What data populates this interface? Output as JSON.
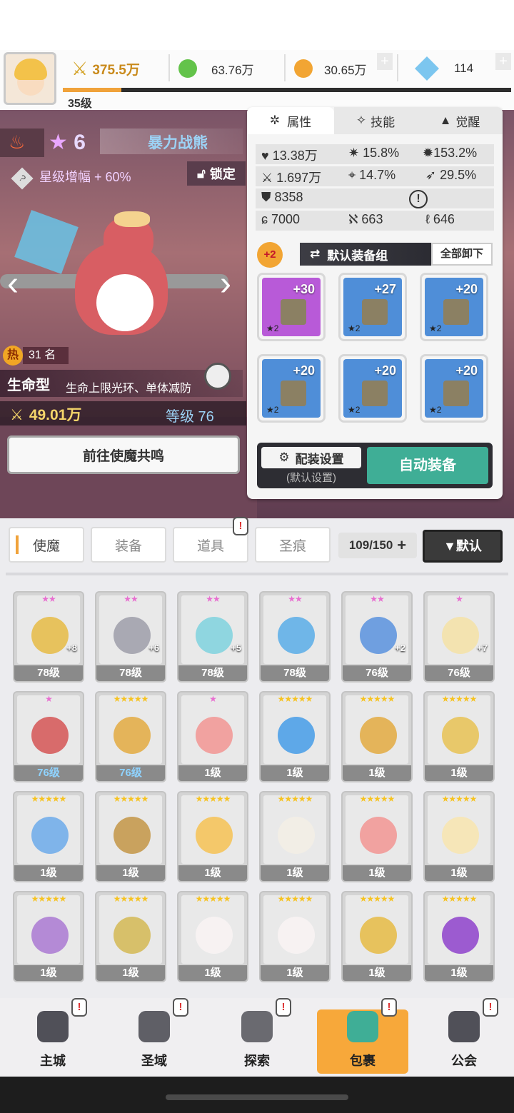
{
  "hud": {
    "level": "35级",
    "power": "375.5万",
    "gems": "63.76万",
    "coins": "30.65万",
    "crystals": "114",
    "xp_progress": 0.13
  },
  "hero": {
    "star_count": "6",
    "name": "暴力战熊",
    "star_boost": "星级增幅 + 60%",
    "lock_label": "锁定",
    "heat_rank": "31 名",
    "heat_label": "热",
    "type": "生命型",
    "type_desc": "生命上限光环、单体减防",
    "power": "49.01万",
    "level": "等级 76",
    "resonate_button": "前往使魔共鸣"
  },
  "panel": {
    "tabs": [
      "属性",
      "技能",
      "觉醒"
    ],
    "stats": {
      "hp": "13.38万",
      "crit": "15.8%",
      "crit_dmg": "153.2%",
      "atk": "1.697万",
      "hit": "14.7%",
      "speed": "29.5%",
      "def": "8358",
      "pierce": "7000",
      "eva": "663",
      "res": "646"
    },
    "equip_badge": "+2",
    "equip_set": "默认装备组",
    "unequip_all": "全部卸下",
    "slots": [
      {
        "plus": "+30",
        "stars": "★2",
        "rarity": "purple",
        "item": "sword-icon"
      },
      {
        "plus": "+27",
        "stars": "★2",
        "rarity": "blue",
        "item": "helmet-icon"
      },
      {
        "plus": "+20",
        "stars": "★2",
        "rarity": "blue",
        "item": "armor-icon"
      },
      {
        "plus": "+20",
        "stars": "★2",
        "rarity": "blue",
        "item": "belt-icon"
      },
      {
        "plus": "+20",
        "stars": "★2",
        "rarity": "blue",
        "item": "amulet-icon"
      },
      {
        "plus": "+20",
        "stars": "★2",
        "rarity": "blue",
        "item": "boots-icon"
      }
    ],
    "equip_settings": "配装设置",
    "equip_settings_sub": "(默认设置)",
    "auto_equip": "自动装备"
  },
  "bag": {
    "tabs": [
      "使魔",
      "装备",
      "道具",
      "圣痕"
    ],
    "capacity": "109/150",
    "sort": "▼默认"
  },
  "heroes": [
    {
      "stars": "★★",
      "level": "78级",
      "plus": "+8",
      "color": "#e7c25d",
      "star_color": "pink"
    },
    {
      "stars": "★★",
      "level": "78级",
      "plus": "+6",
      "color": "#a9a9b3",
      "star_color": "pink"
    },
    {
      "stars": "★★",
      "level": "78级",
      "plus": "+5",
      "color": "#8fd6e0",
      "star_color": "pink"
    },
    {
      "stars": "★★",
      "level": "78级",
      "plus": "",
      "color": "#6fb6e8",
      "star_color": "pink"
    },
    {
      "stars": "★★",
      "level": "76级",
      "plus": "+2",
      "color": "#6f9fe0",
      "star_color": "pink"
    },
    {
      "stars": "★",
      "level": "76级",
      "plus": "+7",
      "color": "#f3e3b0",
      "star_color": "pink"
    },
    {
      "stars": "★",
      "level": "76级",
      "plus": "",
      "color": "#d86b6b",
      "star_color": "pink"
    },
    {
      "stars": "★★★★★",
      "level": "76级",
      "plus": "",
      "color": "#e4b45a",
      "star_color": "gold"
    },
    {
      "stars": "★",
      "level": "1级",
      "plus": "",
      "color": "#f1a2a0",
      "star_color": "pink"
    },
    {
      "stars": "★★★★★",
      "level": "1级",
      "plus": "",
      "color": "#5ea8e8",
      "star_color": "gold"
    },
    {
      "stars": "★★★★★",
      "level": "1级",
      "plus": "",
      "color": "#e4b45a",
      "star_color": "gold"
    },
    {
      "stars": "★★★★★",
      "level": "1级",
      "plus": "",
      "color": "#e8c86a",
      "star_color": "gold"
    },
    {
      "stars": "★★★★★",
      "level": "1级",
      "plus": "",
      "color": "#7fb4ea",
      "star_color": "gold"
    },
    {
      "stars": "★★★★★",
      "level": "1级",
      "plus": "",
      "color": "#c9a25e",
      "star_color": "gold"
    },
    {
      "stars": "★★★★★",
      "level": "1级",
      "plus": "",
      "color": "#f4c86a",
      "star_color": "gold"
    },
    {
      "stars": "★★★★★",
      "level": "1级",
      "plus": "",
      "color": "#f2eee6",
      "star_color": "gold"
    },
    {
      "stars": "★★★★★",
      "level": "1级",
      "plus": "",
      "color": "#f1a2a0",
      "star_color": "gold"
    },
    {
      "stars": "★★★★★",
      "level": "1级",
      "plus": "",
      "color": "#f6e6b8",
      "star_color": "gold"
    },
    {
      "stars": "★★★★★",
      "level": "1级",
      "plus": "",
      "color": "#b48ad6",
      "star_color": "gold"
    },
    {
      "stars": "★★★★★",
      "level": "1级",
      "plus": "",
      "color": "#d7c06a",
      "star_color": "gold"
    },
    {
      "stars": "★★★★★",
      "level": "1级",
      "plus": "",
      "color": "#f7f2f2",
      "star_color": "gold"
    },
    {
      "stars": "★★★★★",
      "level": "1级",
      "plus": "",
      "color": "#f7f2f2",
      "star_color": "gold"
    },
    {
      "stars": "★★★★★",
      "level": "1级",
      "plus": "",
      "color": "#e7c25d",
      "star_color": "gold"
    },
    {
      "stars": "★★★★★",
      "level": "1级",
      "plus": "",
      "color": "#9c5bd0",
      "star_color": "gold"
    }
  ],
  "nav": [
    {
      "label": "主城",
      "icon": "castle-icon"
    },
    {
      "label": "圣域",
      "icon": "portal-icon"
    },
    {
      "label": "探索",
      "icon": "sword-stone-icon"
    },
    {
      "label": "包裹",
      "icon": "backpack-icon"
    },
    {
      "label": "公会",
      "icon": "guild-icon"
    }
  ],
  "colors": {
    "accent_orange": "#f0a23a",
    "auto_equip_green": "#3fae96",
    "nav_active": "#f7a83a"
  }
}
